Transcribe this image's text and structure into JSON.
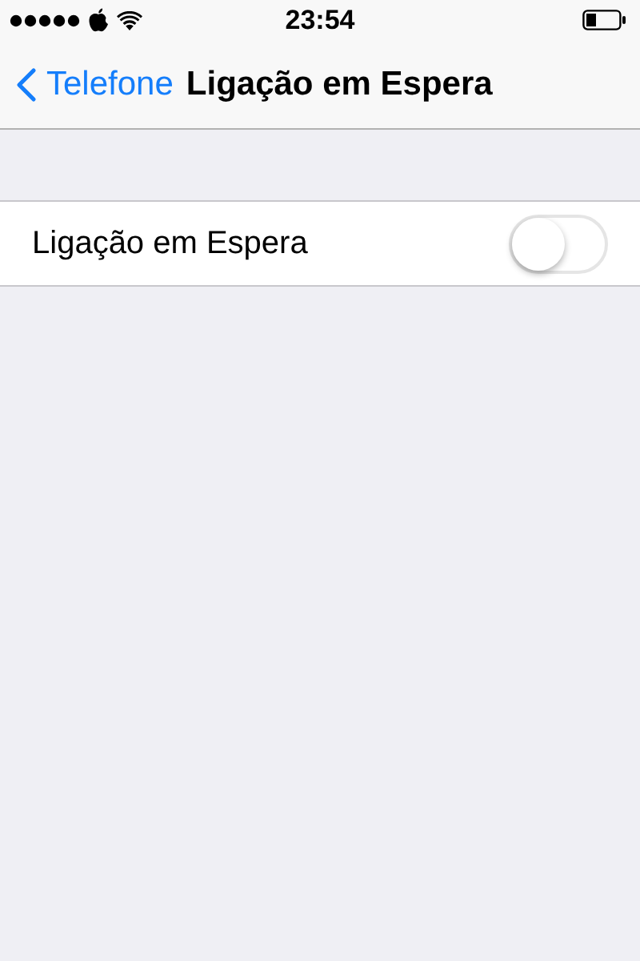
{
  "status_bar": {
    "time": "23:54"
  },
  "nav_bar": {
    "back": "Telefone",
    "title": "Ligação em Espera"
  },
  "settings": [
    {
      "label": "Ligação em Espera",
      "kind": "switch",
      "on": false
    }
  ]
}
